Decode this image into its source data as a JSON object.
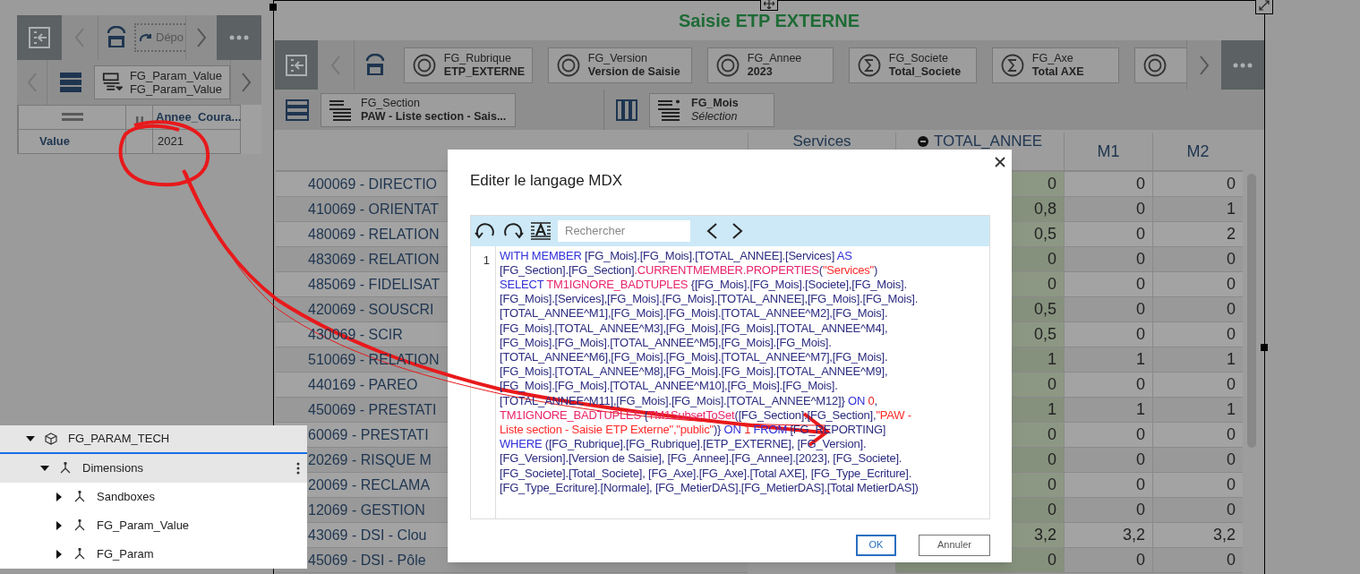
{
  "left_widget": {
    "drop_chip": "Dépo",
    "filter_chip": {
      "label": "FG_Param_Value",
      "value": "FG_Param_Value"
    },
    "table": {
      "column_header": "Annee_Coura...",
      "row_header": "Value",
      "cell": "2021"
    }
  },
  "main_widget": {
    "title": "Saisie ETP EXTERNE",
    "context_chips": [
      {
        "label": "FG_Rubrique",
        "value": "ETP_EXTERNE",
        "kind": "member"
      },
      {
        "label": "FG_Version",
        "value": "Version de Saisie",
        "kind": "member"
      },
      {
        "label": "FG_Annee",
        "value": "2023",
        "kind": "member"
      },
      {
        "label": "FG_Societe",
        "value": "Total_Societe",
        "kind": "sum"
      },
      {
        "label": "FG_Axe",
        "value": "Total AXE",
        "kind": "sum"
      }
    ],
    "row_chip": {
      "label": "FG_Section",
      "value": "PAW - Liste section - Sais..."
    },
    "column_chip": {
      "label": "FG_Mois",
      "value": "Sélection"
    },
    "grid": {
      "columns": [
        "Services",
        "TOTAL_ANNEE",
        "M1",
        "M2"
      ],
      "rows": [
        {
          "label": "400069 - DIRECTIO",
          "total": "0",
          "m1": "0",
          "m2": "0"
        },
        {
          "label": "410069 - ORIENTAT",
          "total": "0,8",
          "m1": "0",
          "m2": "1"
        },
        {
          "label": "480069 - RELATION",
          "total": "0,5",
          "m1": "0",
          "m2": "2"
        },
        {
          "label": "483069 - RELATION",
          "total": "0",
          "m1": "0",
          "m2": "0"
        },
        {
          "label": "485069 - FIDELISAT",
          "total": "0",
          "m1": "0",
          "m2": "0"
        },
        {
          "label": "420069 - SOUSCRI",
          "total": "0,5",
          "m1": "0",
          "m2": "0"
        },
        {
          "label": "430069 - SCIR",
          "total": "0,5",
          "m1": "0",
          "m2": "0"
        },
        {
          "label": "510069 - RELATION",
          "total": "1",
          "m1": "1",
          "m2": "1"
        },
        {
          "label": "440169 - PAREO",
          "total": "0",
          "m1": "0",
          "m2": "0"
        },
        {
          "label": "450069 - PRESTATI",
          "total": "1",
          "m1": "1",
          "m2": "1"
        },
        {
          "label": "60069 - PRESTATI",
          "total": "0",
          "m1": "0",
          "m2": "0"
        },
        {
          "label": "20269 - RISQUE M",
          "total": "0",
          "m1": "0",
          "m2": "0"
        },
        {
          "label": "20069 - RECLAMA",
          "total": "0",
          "m1": "0",
          "m2": "0"
        },
        {
          "label": "12069 - GESTION",
          "total": "0",
          "m1": "0",
          "m2": "0"
        },
        {
          "label": "43069 - DSI - Clou",
          "total": "3,2",
          "m1": "3,2",
          "m2": "3,2"
        },
        {
          "label": "45069 - DSI - Pôle",
          "total": "0",
          "m1": "0",
          "m2": "0"
        }
      ]
    }
  },
  "tree": [
    {
      "label": "FG_PARAM_TECH",
      "kind": "cube",
      "expanded": true,
      "selected": true,
      "focused": true,
      "children": [
        {
          "label": "Dimensions",
          "kind": "hierarchy",
          "expanded": true,
          "selected": true,
          "focused": false,
          "children": [
            {
              "label": "Sandboxes",
              "kind": "hierarchy",
              "expanded": false,
              "selected": false,
              "focused": false
            },
            {
              "label": "FG_Param_Value",
              "kind": "hierarchy",
              "expanded": false,
              "selected": false,
              "focused": false
            },
            {
              "label": "FG_Param",
              "kind": "hierarchy",
              "expanded": false,
              "selected": false,
              "focused": false
            }
          ]
        }
      ]
    }
  ],
  "dialog": {
    "title": "Editer le langage MDX",
    "search": {
      "placeholder": "Rechercher"
    },
    "line_number": "1",
    "code_lines": [
      [
        {
          "text": "WITH MEMBER ",
          "kind": "keyword"
        },
        {
          "text": "[FG_Mois].[FG_Mois].[TOTAL_ANNEE].[Services] ",
          "kind": "plain"
        },
        {
          "text": "AS",
          "kind": "keyword"
        }
      ],
      [
        {
          "text": "[FG_Section].[FG_Section]",
          "kind": "plain"
        },
        {
          "text": ".CURRENTMEMBER.PROPERTIES",
          "kind": "function"
        },
        {
          "text": "(",
          "kind": "plain"
        },
        {
          "text": "\"Services\"",
          "kind": "string"
        },
        {
          "text": ")",
          "kind": "plain"
        }
      ],
      [
        {
          "text": "SELECT ",
          "kind": "keyword"
        },
        {
          "text": "TM1IGNORE_BADTUPLES ",
          "kind": "function"
        },
        {
          "text": "{[FG_Mois].[FG_Mois].[Societe],[FG_Mois].",
          "kind": "plain"
        }
      ],
      [
        {
          "text": "[FG_Mois].[Services],[FG_Mois].[FG_Mois].[TOTAL_ANNEE],[FG_Mois].[FG_Mois].",
          "kind": "plain"
        }
      ],
      [
        {
          "text": "[TOTAL_ANNEE^M1],[FG_Mois].[FG_Mois].[TOTAL_ANNEE^M2],[FG_Mois].",
          "kind": "plain"
        }
      ],
      [
        {
          "text": "[FG_Mois].[TOTAL_ANNEE^M3],[FG_Mois].[FG_Mois].[TOTAL_ANNEE^M4],",
          "kind": "plain"
        }
      ],
      [
        {
          "text": "[FG_Mois].[FG_Mois].[TOTAL_ANNEE^M5],[FG_Mois].[FG_Mois].",
          "kind": "plain"
        }
      ],
      [
        {
          "text": "[TOTAL_ANNEE^M6],[FG_Mois].[FG_Mois].[TOTAL_ANNEE^M7],[FG_Mois].",
          "kind": "plain"
        }
      ],
      [
        {
          "text": "[FG_Mois].[TOTAL_ANNEE^M8],[FG_Mois].[FG_Mois].[TOTAL_ANNEE^M9],",
          "kind": "plain"
        }
      ],
      [
        {
          "text": "[FG_Mois].[FG_Mois].[TOTAL_ANNEE^M10],[FG_Mois].[FG_Mois].",
          "kind": "plain"
        }
      ],
      [
        {
          "text": "[TOTAL_ANNEE^M11],[FG_Mois].[FG_Mois].[TOTAL_ANNEE^M12]} ",
          "kind": "plain"
        },
        {
          "text": "ON ",
          "kind": "keyword"
        },
        {
          "text": "0",
          "kind": "number"
        },
        {
          "text": ",",
          "kind": "plain"
        }
      ],
      [
        {
          "text": "TM1IGNORE_BADTUPLES ",
          "kind": "function"
        },
        {
          "text": "{",
          "kind": "plain"
        },
        {
          "text": "TM1SubsetToSet",
          "kind": "function"
        },
        {
          "text": "([FG_Section].[FG_Section],",
          "kind": "plain"
        },
        {
          "text": "\"PAW -",
          "kind": "string"
        }
      ],
      [
        {
          "text": "Liste section - Saisie ETP Externe\",\"public\"",
          "kind": "string"
        },
        {
          "text": ")} ",
          "kind": "plain"
        },
        {
          "text": "ON ",
          "kind": "keyword"
        },
        {
          "text": "1",
          "kind": "number"
        },
        {
          "text": " FROM ",
          "kind": "keyword"
        },
        {
          "text": "[FG_REPORTING]",
          "kind": "plain"
        }
      ],
      [
        {
          "text": "WHERE ",
          "kind": "keyword"
        },
        {
          "text": "([FG_Rubrique].[FG_Rubrique].[ETP_EXTERNE], [FG_Version].",
          "kind": "plain"
        }
      ],
      [
        {
          "text": "[FG_Version].[Version de Saisie], [FG_Annee].[FG_Annee].[2023], [FG_Societe].",
          "kind": "plain"
        }
      ],
      [
        {
          "text": "[FG_Societe].[Total_Societe], [FG_Axe].[FG_Axe].[Total AXE], [FG_Type_Ecriture].",
          "kind": "plain"
        }
      ],
      [
        {
          "text": "[FG_Type_Ecriture].[Normale], [FG_MetierDAS].[FG_MetierDAS].[Total MetierDAS])",
          "kind": "plain"
        }
      ]
    ],
    "buttons": [
      {
        "label": "OK",
        "kind": "primary"
      },
      {
        "label": "Annuler",
        "kind": "secondary"
      }
    ]
  }
}
